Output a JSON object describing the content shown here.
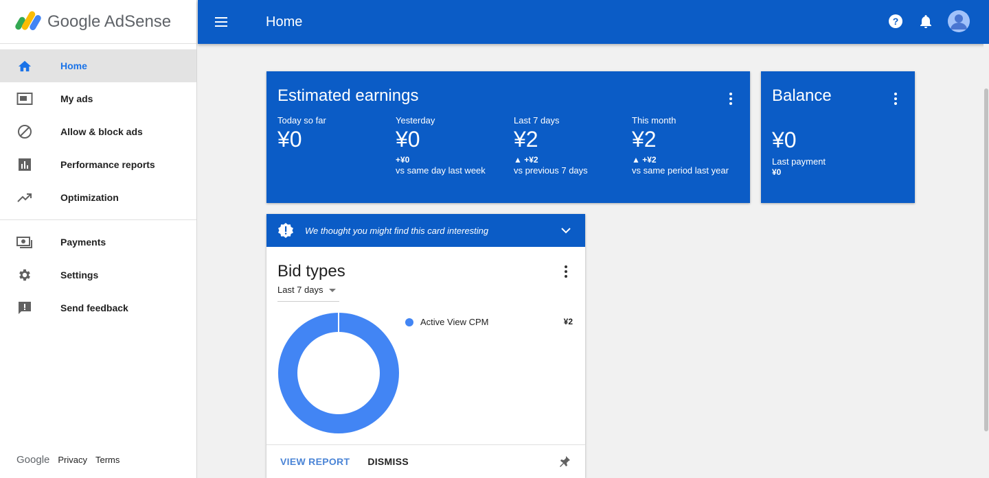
{
  "brand": {
    "name": "Google AdSense"
  },
  "sidebar": {
    "items": [
      {
        "label": "Home",
        "icon": "home-icon",
        "active": true
      },
      {
        "label": "My ads",
        "icon": "ad-unit-icon"
      },
      {
        "label": "Allow & block ads",
        "icon": "block-icon"
      },
      {
        "label": "Performance reports",
        "icon": "bar-chart-icon"
      },
      {
        "label": "Optimization",
        "icon": "trending-up-icon"
      },
      {
        "label": "Payments",
        "icon": "payments-icon"
      },
      {
        "label": "Settings",
        "icon": "gear-icon"
      },
      {
        "label": "Send feedback",
        "icon": "feedback-icon"
      }
    ],
    "footer": {
      "google": "Google",
      "privacy": "Privacy",
      "terms": "Terms"
    }
  },
  "header": {
    "title": "Home"
  },
  "earnings": {
    "title": "Estimated earnings",
    "periods": [
      {
        "label": "Today so far",
        "value": "¥0",
        "delta": "",
        "comparison": ""
      },
      {
        "label": "Yesterday",
        "value": "¥0",
        "delta": "+¥0",
        "comparison": "vs same day last week"
      },
      {
        "label": "Last 7 days",
        "value": "¥2",
        "delta": "▲ +¥2",
        "comparison": "vs previous 7 days"
      },
      {
        "label": "This month",
        "value": "¥2",
        "delta": "▲ +¥2",
        "comparison": "vs same period last year"
      }
    ]
  },
  "balance": {
    "title": "Balance",
    "value": "¥0",
    "last_payment_label": "Last payment",
    "last_payment_value": "¥0"
  },
  "bid_card": {
    "banner": "We thought you might find this card interesting",
    "title": "Bid types",
    "range": "Last 7 days",
    "legend": [
      {
        "label": "Active View CPM",
        "value": "¥2",
        "color": "#4285f4"
      }
    ],
    "view_report": "VIEW REPORT",
    "dismiss": "DISMISS"
  },
  "chart_data": {
    "type": "pie",
    "categories": [
      "Active View CPM"
    ],
    "values": [
      2
    ],
    "colors": [
      "#4285f4"
    ]
  },
  "colors": {
    "primary": "#0b5cc6",
    "accent": "#1a73e8",
    "series": "#4285f4"
  }
}
